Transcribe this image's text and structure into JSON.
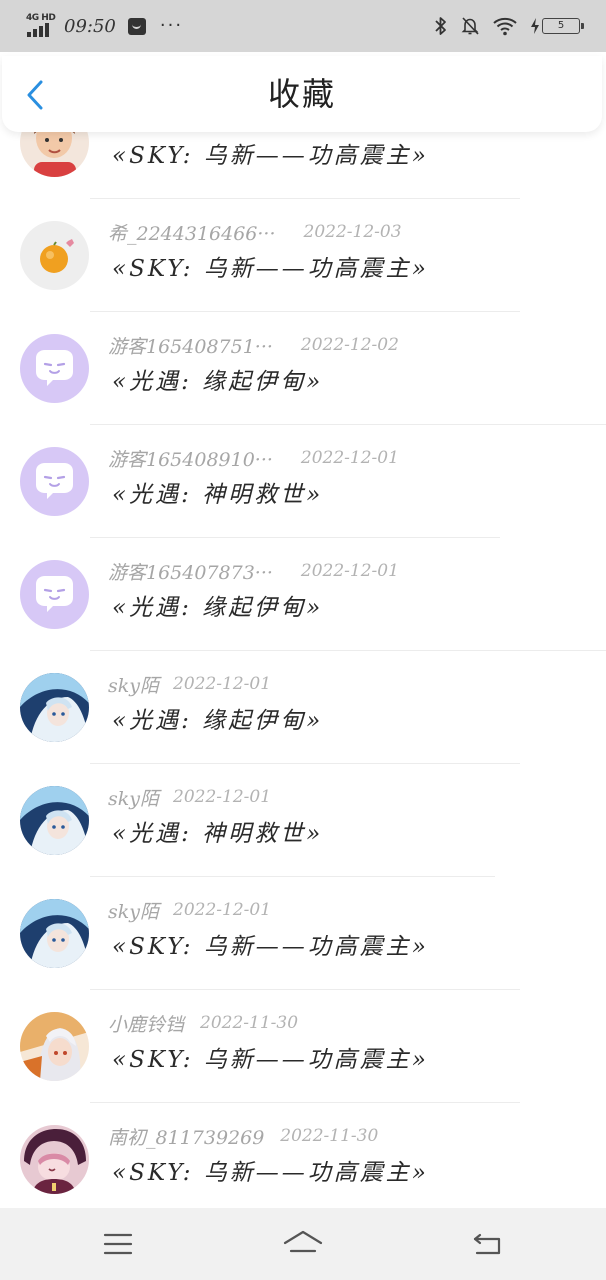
{
  "status_bar": {
    "network": "4G HD",
    "time": "09:50",
    "more": "···",
    "battery": "5"
  },
  "header": {
    "title": "收藏"
  },
  "items": [
    {
      "author": "",
      "date": "",
      "title": "«SKY: 乌新——功高震主»"
    },
    {
      "author": "希_2244316466···",
      "date": "2022-12-03",
      "title": "«SKY: 乌新——功高震主»"
    },
    {
      "author": "游客165408751···",
      "date": "2022-12-02",
      "title": "«光遇: 缘起伊甸»"
    },
    {
      "author": "游客165408910···",
      "date": "2022-12-01",
      "title": "«光遇: 神明救世»"
    },
    {
      "author": "游客165407873···",
      "date": "2022-12-01",
      "title": "«光遇: 缘起伊甸»"
    },
    {
      "author": "sky陌",
      "date": "2022-12-01",
      "title": "«光遇: 缘起伊甸»"
    },
    {
      "author": "sky陌",
      "date": "2022-12-01",
      "title": "«光遇: 神明救世»"
    },
    {
      "author": "sky陌",
      "date": "2022-12-01",
      "title": "«SKY: 乌新——功高震主»"
    },
    {
      "author": "小鹿铃铛",
      "date": "2022-11-30",
      "title": "«SKY: 乌新——功高震主»"
    },
    {
      "author": "南初_811739269",
      "date": "2022-11-30",
      "title": "«SKY: 乌新——功高震主»"
    }
  ],
  "colors": {
    "accent": "#2a8fe0",
    "status_bar_bg": "#d6d6d6",
    "nav_bg": "#f1f1f1",
    "meta_text": "#a6a6a6",
    "guest_avatar_bg": "#d7c8f6"
  }
}
